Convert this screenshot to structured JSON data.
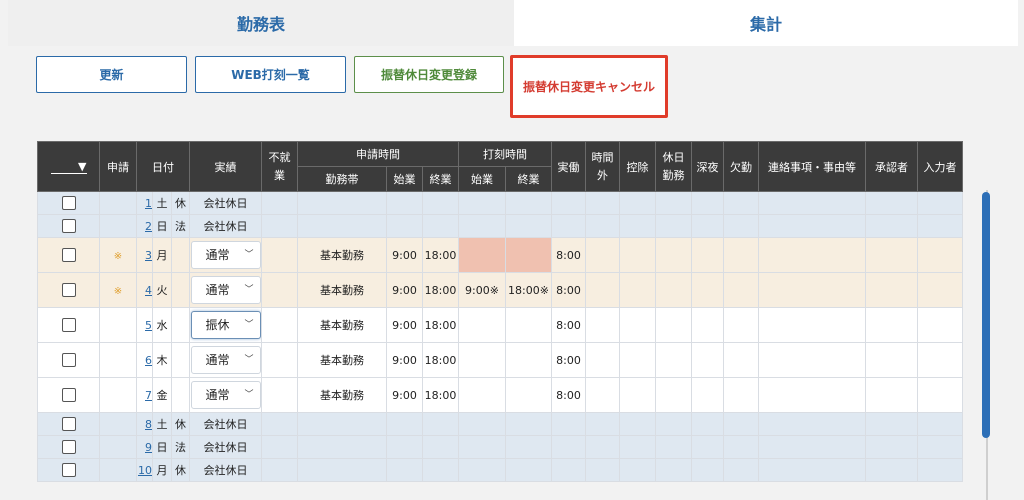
{
  "tabs": {
    "attendance": "勤務表",
    "summary": "集計"
  },
  "buttons": {
    "refresh": "更新",
    "web_punch_list": "WEB打刻一覧",
    "substitute_register": "振替休日変更登録",
    "substitute_cancel": "振替休日変更キャンセル"
  },
  "table": {
    "headers": {
      "sort": "▼",
      "apply": "申請",
      "date": "日付",
      "actual": "実績",
      "not_working": "不就業",
      "apply_time": "申請時間",
      "shift": "勤務帯",
      "start": "始業",
      "end": "終業",
      "punch_time": "打刻時間",
      "punch_start": "始業",
      "punch_end": "終業",
      "worked": "実働",
      "overtime": "時間外",
      "deduction": "控除",
      "holiday_work": "休日勤務",
      "late_night": "深夜",
      "absence": "欠勤",
      "notes": "連絡事項・事由等",
      "approver": "承認者",
      "inputter": "入力者"
    },
    "rows": [
      {
        "kind": "holiday",
        "mark": "",
        "day": "1",
        "weekday": "土",
        "hol": "休",
        "actual": "会社休日",
        "shift": "",
        "start": "",
        "end": "",
        "p_start": "",
        "p_end": "",
        "worked": ""
      },
      {
        "kind": "holiday",
        "mark": "",
        "day": "2",
        "weekday": "日",
        "hol": "法",
        "actual": "会社休日",
        "shift": "",
        "start": "",
        "end": "",
        "p_start": "",
        "p_end": "",
        "worked": ""
      },
      {
        "kind": "applied",
        "mark": "※",
        "day": "3",
        "weekday": "月",
        "hol": "",
        "actual": "通常",
        "shift": "基本勤務",
        "start": "9:00",
        "end": "18:00",
        "p_start": "",
        "p_end": "",
        "worked": "8:00"
      },
      {
        "kind": "applied",
        "mark": "※",
        "day": "4",
        "weekday": "火",
        "hol": "",
        "actual": "通常",
        "shift": "基本勤務",
        "start": "9:00",
        "end": "18:00",
        "p_start": "9:00※",
        "p_end": "18:00※",
        "worked": "8:00"
      },
      {
        "kind": "normal",
        "mark": "",
        "day": "5",
        "weekday": "水",
        "hol": "",
        "actual": "振休",
        "shift": "基本勤務",
        "start": "9:00",
        "end": "18:00",
        "p_start": "",
        "p_end": "",
        "worked": "8:00"
      },
      {
        "kind": "normal",
        "mark": "",
        "day": "6",
        "weekday": "木",
        "hol": "",
        "actual": "通常",
        "shift": "基本勤務",
        "start": "9:00",
        "end": "18:00",
        "p_start": "",
        "p_end": "",
        "worked": "8:00"
      },
      {
        "kind": "normal",
        "mark": "",
        "day": "7",
        "weekday": "金",
        "hol": "",
        "actual": "通常",
        "shift": "基本勤務",
        "start": "9:00",
        "end": "18:00",
        "p_start": "",
        "p_end": "",
        "worked": "8:00"
      },
      {
        "kind": "holiday",
        "mark": "",
        "day": "8",
        "weekday": "土",
        "hol": "休",
        "actual": "会社休日",
        "shift": "",
        "start": "",
        "end": "",
        "p_start": "",
        "p_end": "",
        "worked": ""
      },
      {
        "kind": "holiday",
        "mark": "",
        "day": "9",
        "weekday": "日",
        "hol": "法",
        "actual": "会社休日",
        "shift": "",
        "start": "",
        "end": "",
        "p_start": "",
        "p_end": "",
        "worked": ""
      },
      {
        "kind": "holiday",
        "mark": "",
        "day": "10",
        "weekday": "月",
        "hol": "休",
        "actual": "会社休日",
        "shift": "",
        "start": "",
        "end": "",
        "p_start": "",
        "p_end": "",
        "worked": ""
      }
    ]
  }
}
